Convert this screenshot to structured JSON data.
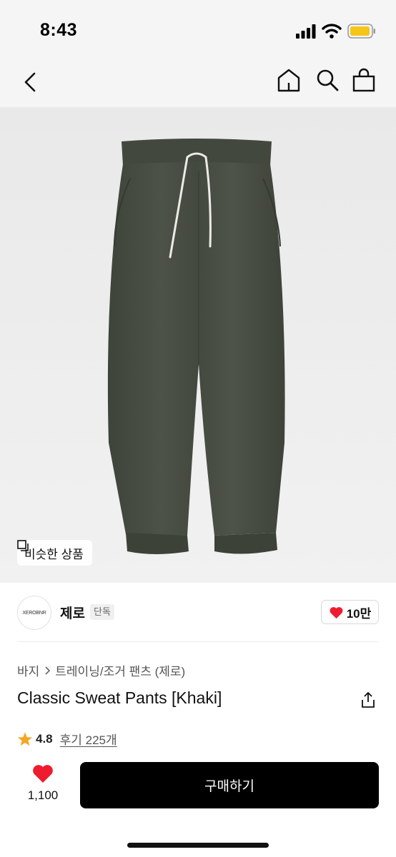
{
  "status_bar": {
    "time": "8:43",
    "battery_color": "#f5c518"
  },
  "nav": {
    "back_icon": "chevron-left-icon",
    "home_icon": "home-icon",
    "search_icon": "search-icon",
    "bag_icon": "shopping-bag-icon"
  },
  "hero": {
    "image_subject": "khaki sweat pants",
    "pants_color": "#4a4f45",
    "similar_label": "비슷한 상품"
  },
  "brand": {
    "logo_text": "XEROBNR",
    "name": "제로",
    "badge": "단독",
    "likes": "10만"
  },
  "breadcrumb": {
    "category": "바지",
    "subcategory": "트레이닝/조거 팬츠 (제로)"
  },
  "product": {
    "title": "Classic Sweat Pants [Khaki]",
    "rating": "4.8",
    "reviews": "후기 225개"
  },
  "purchase": {
    "wish_count": "1,100",
    "buy_label": "구매하기"
  },
  "colors": {
    "heart": "#ee1c2e",
    "star": "#f5a623",
    "button": "#000000"
  }
}
